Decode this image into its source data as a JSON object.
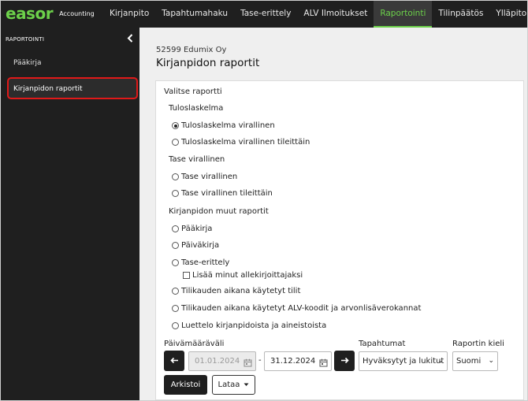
{
  "brand": {
    "name": "easor",
    "sub": "Accounting",
    "color": "#6cd14a"
  },
  "nav": {
    "items": [
      {
        "label": "Kirjanpito",
        "active": false
      },
      {
        "label": "Tapahtumahaku",
        "active": false
      },
      {
        "label": "Tase-erittely",
        "active": false
      },
      {
        "label": "ALV Ilmoitukset",
        "active": false
      },
      {
        "label": "Raportointi",
        "active": true
      },
      {
        "label": "Tilinpäätös",
        "active": false
      },
      {
        "label": "Ylläpito",
        "active": false
      }
    ]
  },
  "sidebar": {
    "heading": "RAPORTOINTI",
    "collapse_icon": "chevron-left-icon",
    "items": [
      {
        "label": "Pääkirja",
        "selected": false
      },
      {
        "label": "Kirjanpidon raportit",
        "selected": true
      }
    ],
    "highlight_color": "#e01919"
  },
  "page": {
    "company": "52599 Edumix Oy",
    "title": "Kirjanpidon raportit"
  },
  "form": {
    "title": "Valitse raportti",
    "groups": [
      {
        "label": "Tuloslaskelma",
        "options": [
          {
            "label": "Tuloslaskelma virallinen",
            "checked": true
          },
          {
            "label": "Tuloslaskelma virallinen tileittäin",
            "checked": false
          }
        ]
      },
      {
        "label": "Tase virallinen",
        "options": [
          {
            "label": "Tase virallinen",
            "checked": false
          },
          {
            "label": "Tase virallinen tileittäin",
            "checked": false
          }
        ]
      },
      {
        "label": "Kirjanpidon muut raportit",
        "options": [
          {
            "label": "Pääkirja",
            "checked": false
          },
          {
            "label": "Päiväkirja",
            "checked": false
          },
          {
            "label": "Tase-erittely",
            "checked": false
          },
          {
            "label": "Tilikauden aikana käytetyt tilit",
            "checked": false
          },
          {
            "label": "Tilikauden aikana käytetyt ALV-koodit ja arvonlisäverokannat",
            "checked": false
          },
          {
            "label": "Luettelo kirjanpidoista ja aineistoista",
            "checked": false
          }
        ]
      }
    ],
    "signer_checkbox": {
      "label": "Lisää minut allekirjoittajaksi",
      "checked": false
    },
    "date_range": {
      "label": "Päivämääräväli",
      "prev_icon": "arrow-left-icon",
      "next_icon": "arrow-right-icon",
      "start": "01.01.2024",
      "separator": "-",
      "end": "31.12.2024"
    },
    "transactions": {
      "label": "Tapahtumat",
      "value": "Hyväksytyt ja lukitut"
    },
    "language": {
      "label": "Raportin kieli",
      "value": "Suomi"
    },
    "archive_button": "Arkistoi",
    "download_button": "Lataa"
  }
}
